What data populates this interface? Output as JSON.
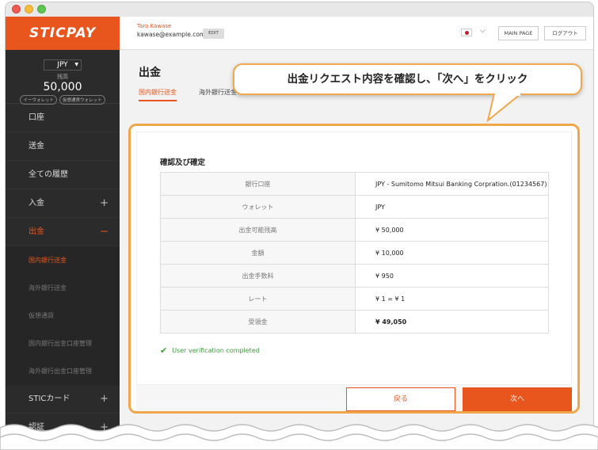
{
  "sidebar": {
    "logo": "STICPAY",
    "currency": "JPY",
    "balance_label": "残高",
    "balance_amount": "50,000",
    "wallet_tabs": [
      "イーウォレット",
      "仮想通貨ウォレット"
    ],
    "nav": [
      {
        "label": "口座"
      },
      {
        "label": "送金"
      },
      {
        "label": "全ての履歴"
      },
      {
        "label": "入金",
        "toggle": "+"
      },
      {
        "label": "出金",
        "toggle": "−"
      }
    ],
    "sub_items": [
      "国内銀行送金",
      "海外銀行送金",
      "仮想通貨",
      "国内銀行出金口座管理",
      "海外銀行出金口座管理"
    ],
    "nav_bottom": [
      {
        "label": "STICカード",
        "toggle": "+"
      },
      {
        "label": "認証",
        "toggle": "+"
      }
    ]
  },
  "topbar": {
    "user_name": "Taro Kawase",
    "user_email": "kawase@example.com",
    "edit_label": "EDIT",
    "main_page_label": "MAIN PAGE",
    "logout_label": "ログアウト"
  },
  "page": {
    "title": "出金",
    "tabs": [
      "国内銀行送金",
      "海外銀行送金"
    ]
  },
  "callout": {
    "text": "出金リクエスト内容を確認し、「次へ」をクリック"
  },
  "confirm": {
    "title": "確認及び確定",
    "rows": [
      {
        "label": "銀行口座",
        "value": "JPY - Sumitomo Mitsui Banking Corpration.(01234567)"
      },
      {
        "label": "ウォレット",
        "value": "JPY"
      },
      {
        "label": "出金可能残高",
        "value": "¥ 50,000"
      },
      {
        "label": "金額",
        "value": "¥ 10,000"
      },
      {
        "label": "出金手数料",
        "value": "¥ 950"
      },
      {
        "label": "レート",
        "value": "¥ 1 = ¥ 1"
      },
      {
        "label": "受領金",
        "value": "¥ 49,050"
      }
    ],
    "verification": "User verification completed",
    "back_label": "戻る",
    "next_label": "次へ"
  },
  "colors": {
    "accent": "#e8561e",
    "highlight": "#f0a64a",
    "success": "#3a9c3a"
  }
}
